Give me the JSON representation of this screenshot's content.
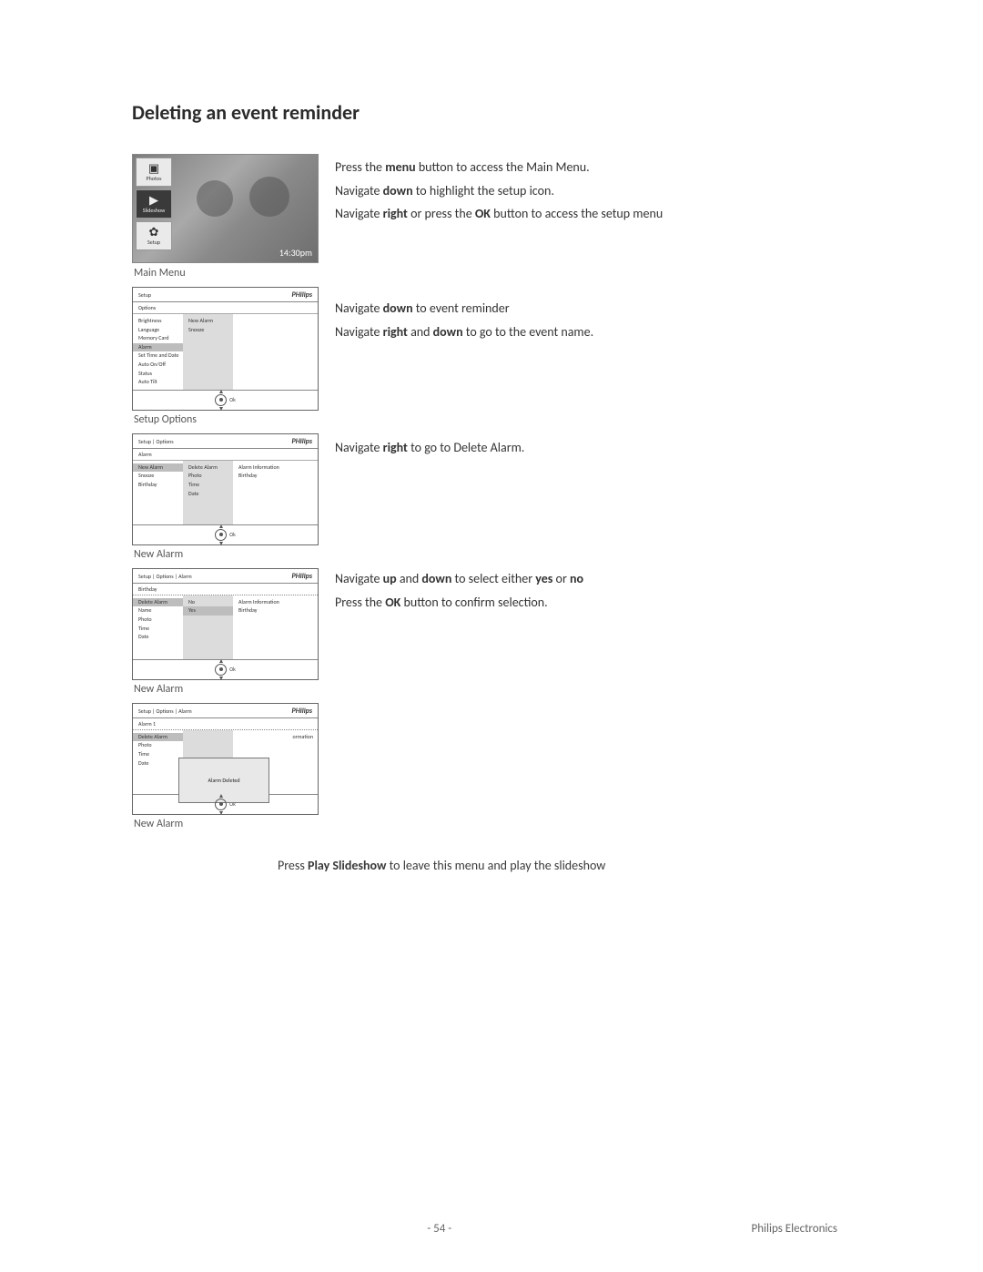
{
  "heading": "Deleting an event reminder",
  "fig1": {
    "tile_photos": "Photos",
    "tile_slideshow": "Slideshow",
    "tile_setup": "Setup",
    "time": "14:30pm",
    "caption": "Main Menu"
  },
  "instr1": {
    "l1a": "Press the ",
    "l1b": "menu",
    "l1c": " button to access the Main Menu.",
    "l2a": "Navigate ",
    "l2b": "down",
    "l2c": " to highlight the setup icon.",
    "l3a": "Navigate ",
    "l3b": "right",
    "l3c": "  or  press the ",
    "l3d": "OK",
    "l3e": " button to  access the setup menu"
  },
  "fig2": {
    "breadcrumb": "Setup",
    "brand": "PHilips",
    "row2": "Options",
    "c1": [
      "Brightness",
      "Language",
      "Memory Card",
      "Alarm",
      "Set Time and Date",
      "Auto On/Off",
      "Status",
      "Auto Tilt"
    ],
    "c2": [
      "New Alarm",
      "Snooze"
    ],
    "caption": "Setup Options",
    "ok": "Ok"
  },
  "instr2": {
    "l1a": "Navigate ",
    "l1b": "down",
    "l1c": " to event reminder",
    "l2a": "Navigate ",
    "l2b": "right",
    "l2c": " and ",
    "l2d": "down",
    "l2e": " to go to the event name."
  },
  "fig3": {
    "breadcrumb": "Setup | Options",
    "brand": "PHilips",
    "row2": "Alarm",
    "c1": [
      "New Alarm",
      "Snooze",
      "Birthday"
    ],
    "c2": [
      "Delete Alarm",
      "Photo",
      "Time",
      "Date"
    ],
    "c3": [
      "Alarm Information",
      "Birthday"
    ],
    "caption": "New Alarm",
    "ok": "Ok"
  },
  "instr3": {
    "l1a": "Navigate ",
    "l1b": "right",
    "l1c": " to go to Delete Alarm."
  },
  "fig4": {
    "breadcrumb": "Setup | Options | Alarm",
    "brand": "PHilips",
    "row2": "Birthday",
    "c1": [
      "Delete Alarm",
      "Name",
      "Photo",
      "Time",
      "Date"
    ],
    "c2": [
      "No",
      "Yes"
    ],
    "c3": [
      "Alarm Information",
      "Birthday"
    ],
    "caption": "New Alarm",
    "ok": "Ok"
  },
  "instr4": {
    "l1a": "Navigate ",
    "l1b": "up",
    "l1c": " and ",
    "l1d": "down",
    "l1e": " to select either ",
    "l1f": "yes",
    "l1g": " or ",
    "l1h": "no",
    "l2a": "Press the ",
    "l2b": "OK",
    "l2c": " button to confirm selection."
  },
  "fig5": {
    "breadcrumb": "Setup | Options | Alarm",
    "brand": "PHilips",
    "row2": "Alarm 1",
    "c1": [
      "Delete Alarm",
      "",
      "Photo",
      "Time",
      "Date"
    ],
    "c3_hint": "ormation",
    "popup": "Alarm Deleted",
    "caption": "New Alarm",
    "ok": "Ok"
  },
  "bottom": {
    "a": "Press ",
    "b": "Play Slideshow",
    "c": " to leave this menu and play the slideshow"
  },
  "footer": {
    "page": "- 54 -",
    "company": "Philips Electronics"
  }
}
